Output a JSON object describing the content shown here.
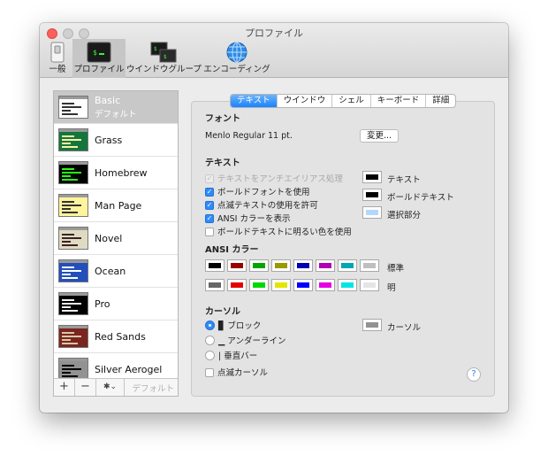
{
  "window": {
    "title": "プロファイル"
  },
  "toolbar": [
    {
      "label": "一般",
      "icon": "switch-icon"
    },
    {
      "label": "プロファイル",
      "icon": "terminal-icon",
      "active": true
    },
    {
      "label": "ウインドウグループ",
      "icon": "window-group-icon"
    },
    {
      "label": "エンコーディング",
      "icon": "globe-icon"
    }
  ],
  "profiles": [
    {
      "name": "Basic",
      "subtitle": "デフォルト",
      "selected": true,
      "bg": "#ffffff",
      "fg": "#333333"
    },
    {
      "name": "Grass",
      "bg": "#13773d",
      "fg": "#fff0a5"
    },
    {
      "name": "Homebrew",
      "bg": "#000000",
      "fg": "#28fe14"
    },
    {
      "name": "Man Page",
      "bg": "#fef49c",
      "fg": "#333333"
    },
    {
      "name": "Novel",
      "bg": "#dfdbc3",
      "fg": "#3b2322"
    },
    {
      "name": "Ocean",
      "bg": "#224fbc",
      "fg": "#ffffff"
    },
    {
      "name": "Pro",
      "bg": "#000000",
      "fg": "#f2f2f2"
    },
    {
      "name": "Red Sands",
      "bg": "#7a251e",
      "fg": "#d7c9a7"
    },
    {
      "name": "Silver Aerogel",
      "bg": "#929292",
      "fg": "#000000"
    }
  ],
  "sidebar_bottom": {
    "add": "+",
    "remove": "−",
    "gear": "✱⌄",
    "default_label": "デフォルト"
  },
  "tabs": [
    {
      "label": "テキスト",
      "active": true
    },
    {
      "label": "ウインドウ"
    },
    {
      "label": "シェル"
    },
    {
      "label": "キーボード"
    },
    {
      "label": "詳細"
    }
  ],
  "font": {
    "section": "フォント",
    "value": "Menlo Regular 11 pt.",
    "change_button": "変更..."
  },
  "text": {
    "section": "テキスト",
    "options": [
      {
        "label": "テキストをアンチエイリアス処理",
        "checked": true,
        "disabled": true
      },
      {
        "label": "ボールドフォントを使用",
        "checked": true
      },
      {
        "label": "点滅テキストの使用を許可",
        "checked": true
      },
      {
        "label": "ANSI カラーを表示",
        "checked": true
      },
      {
        "label": "ボールドテキストに明るい色を使用",
        "checked": false
      }
    ],
    "colors": [
      {
        "label": "テキスト",
        "color": "#000000"
      },
      {
        "label": "ボールドテキスト",
        "color": "#000000"
      },
      {
        "label": "選択部分",
        "color": "#b4d7fe"
      }
    ]
  },
  "ansi": {
    "section": "ANSI カラー",
    "normal_label": "標準",
    "bright_label": "明",
    "normal": [
      "#000000",
      "#990000",
      "#00a600",
      "#999900",
      "#0000b2",
      "#b200b2",
      "#00a6b2",
      "#bfbfbf"
    ],
    "bright": [
      "#666666",
      "#e50000",
      "#00d900",
      "#e5e500",
      "#0000ff",
      "#e500e5",
      "#00e5e5",
      "#e5e5e5"
    ]
  },
  "cursor": {
    "section": "カーソル",
    "options": [
      {
        "glyph": "▊",
        "label": "ブロック",
        "selected": true
      },
      {
        "glyph": "▁",
        "label": "アンダーライン",
        "selected": false
      },
      {
        "glyph": "|",
        "label": "垂直バー",
        "selected": false
      }
    ],
    "blink_label": "点滅カーソル",
    "blink_checked": false,
    "color_label": "カーソル",
    "color": "#929292"
  },
  "help": "?"
}
